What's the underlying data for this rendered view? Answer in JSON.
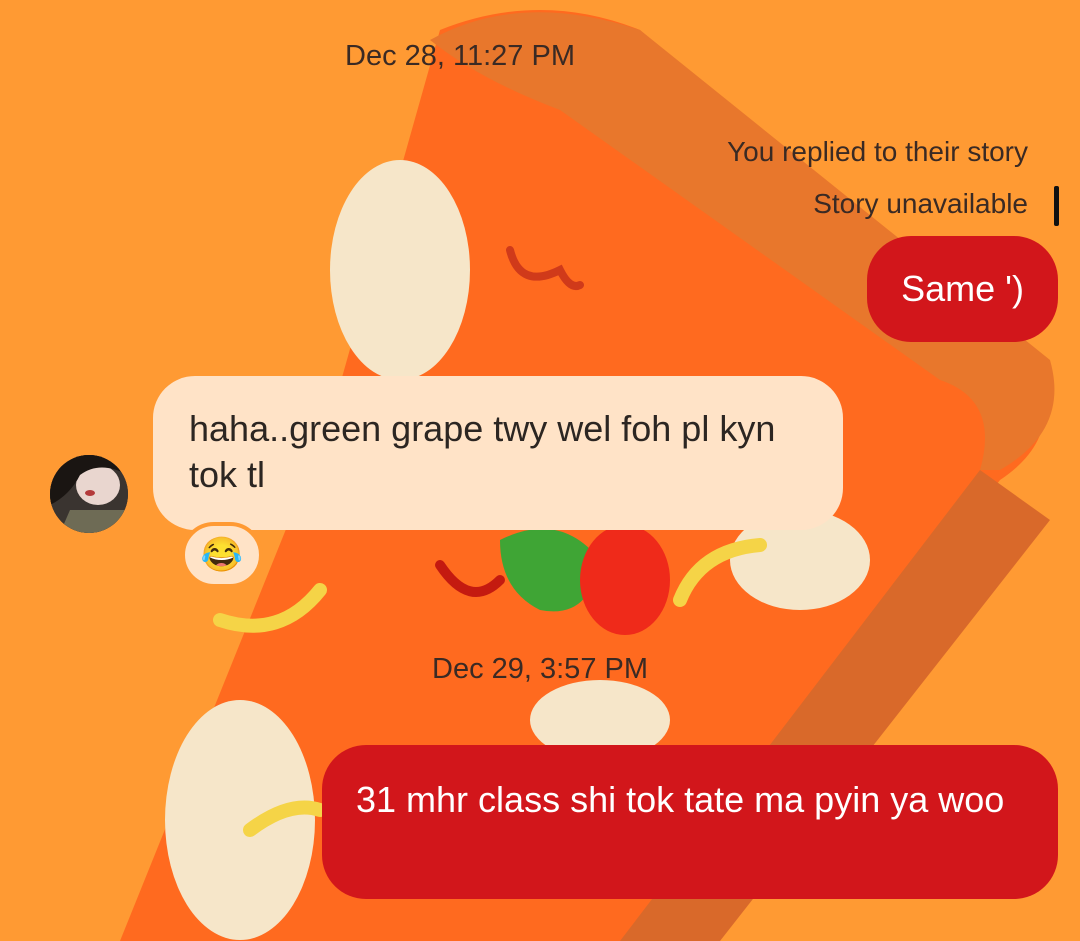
{
  "thread": {
    "timestamp_1": "Dec 28, 11:27 PM",
    "story_reply_label": "You replied to their story",
    "story_unavailable_label": "Story unavailable",
    "timestamp_2": "Dec 29, 3:57 PM"
  },
  "messages": [
    {
      "sender": "me",
      "text": "Same ')"
    },
    {
      "sender": "them",
      "text": "haha..green grape twy wel foh pl kyn tok tl",
      "reaction": "😂"
    },
    {
      "sender": "me",
      "text": "31 mhr class shi tok tate ma pyin ya woo"
    }
  ],
  "colors": {
    "background": "#FF9A33",
    "outgoing_bubble": "#D2161B",
    "incoming_bubble": "#FFE3C7"
  },
  "icons": {
    "reaction": "laughing-tears-emoji",
    "avatar": "contact-avatar"
  }
}
